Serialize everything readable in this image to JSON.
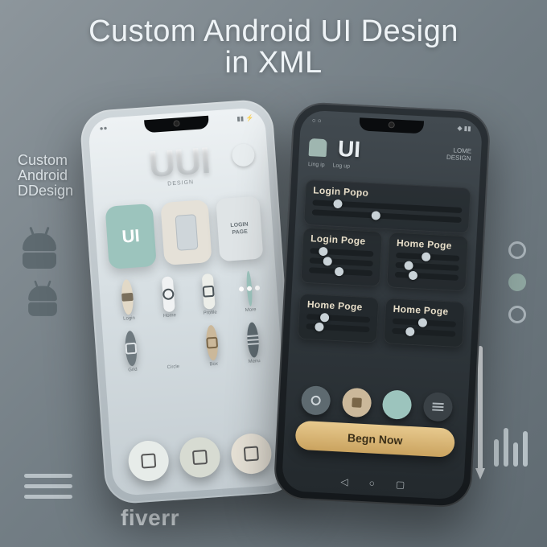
{
  "title_line1": "Custom Android UI Design",
  "title_line2": "in XML",
  "side_label": "Custom Android DDesign",
  "footer_brand": "fiverr",
  "phone1": {
    "hero": "UUI",
    "hero_sub": "DESIGN",
    "card3_line1": "LOGIN",
    "card3_line2": "PAGE",
    "card_ui": "UI",
    "icon_labels": [
      "Login",
      "Home",
      "Profile",
      "More",
      "Grid",
      "Circle",
      "Box",
      "Menu"
    ]
  },
  "phone2": {
    "brand": "UI",
    "side_tag1": "LOME",
    "side_tag2": "DESIGN",
    "mini1": "Ling ip",
    "mini2": "Log up",
    "section1": "Login Popo",
    "section2": "Login Poge",
    "section3": "Home Poge",
    "section4": "Home Poge",
    "section5": "Home Poge",
    "cta": "Begn Now"
  },
  "colors": {
    "teal": "#9cc4bd",
    "cream": "#e5e1d8",
    "tan": "#cbb89a",
    "slate": "#6f7a80",
    "gold": "#e7c98e"
  }
}
